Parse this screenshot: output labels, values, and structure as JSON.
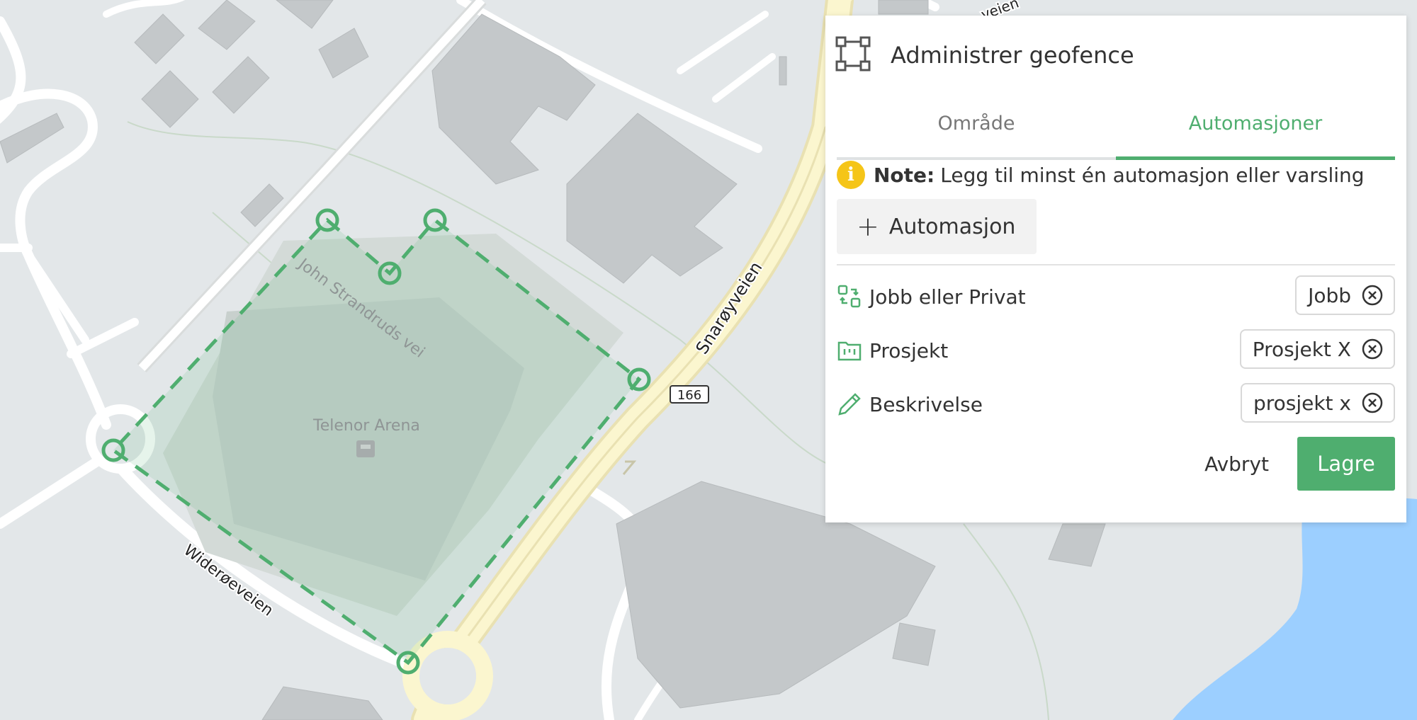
{
  "map": {
    "streets": {
      "john_strandruds_vei": "John Strandruds vei",
      "snaroyveien": "Snarøyveien",
      "wideroeveien": "Widerøeveien",
      "top_partial": "veien"
    },
    "route_shield": "166",
    "poi": "Telenor Arena",
    "geofence_color": "#4fae6f"
  },
  "panel": {
    "title": "Administrer geofence",
    "title_icon": "bounding-box-icon",
    "tabs": [
      {
        "label": "Område",
        "active": false
      },
      {
        "label": "Automasjoner",
        "active": true
      }
    ],
    "note": {
      "icon": "info-icon",
      "prefix": "Note:",
      "text": "Legg til minst én automasjon eller varsling"
    },
    "add_button": "Automasjon",
    "rows": [
      {
        "icon": "switch-icon",
        "label": "Jobb eller Privat",
        "value": "Jobb"
      },
      {
        "icon": "folder-project-icon",
        "label": "Prosjekt",
        "value": "Prosjekt X"
      },
      {
        "icon": "pencil-icon",
        "label": "Beskrivelse",
        "value": "prosjekt x"
      }
    ],
    "cancel": "Avbryt",
    "save": "Lagre"
  },
  "colors": {
    "accent": "#4fae6f",
    "note_badge": "#f5c518",
    "water": "#9ccfff",
    "major_road": "#fbf6cf"
  }
}
